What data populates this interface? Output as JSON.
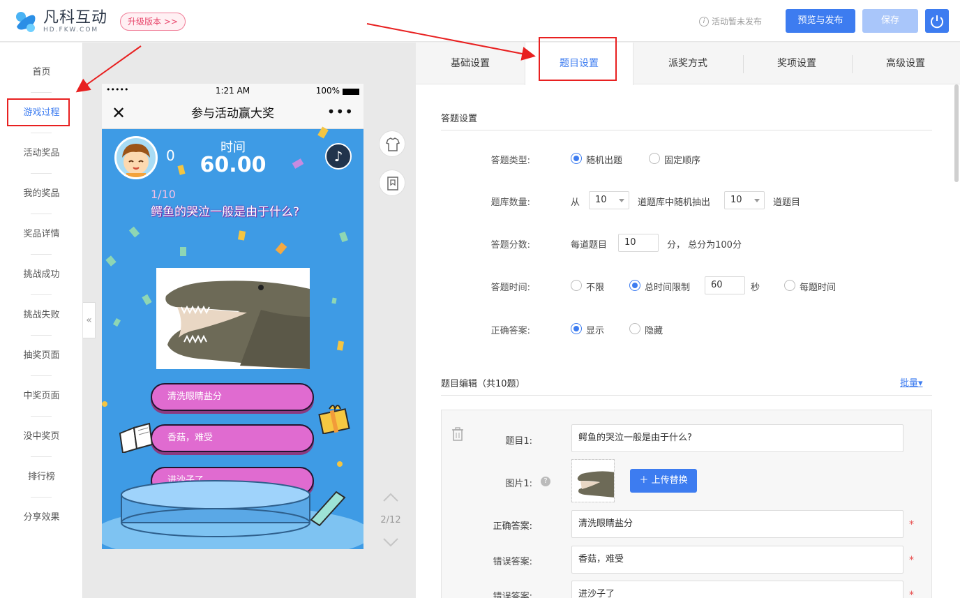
{
  "header": {
    "logo_cn": "凡科互动",
    "logo_en": "HD.FKW.COM",
    "upgrade_label": "升级版本 >>",
    "status_text": "活动暂未发布",
    "preview_publish_label": "预览与发布",
    "save_label": "保存"
  },
  "sidebar": {
    "items": [
      {
        "label": "首页"
      },
      {
        "label": "游戏过程"
      },
      {
        "label": "活动奖品"
      },
      {
        "label": "我的奖品"
      },
      {
        "label": "奖品详情"
      },
      {
        "label": "挑战成功"
      },
      {
        "label": "挑战失败"
      },
      {
        "label": "抽奖页面"
      },
      {
        "label": "中奖页面"
      },
      {
        "label": "没中奖页"
      },
      {
        "label": "排行榜"
      },
      {
        "label": "分享效果"
      }
    ],
    "collapse_label": "«"
  },
  "phone": {
    "signal": "•••••",
    "time": "1:21 AM",
    "battery": "100%",
    "title": "参与活动赢大奖",
    "close": "✕",
    "more": "•••",
    "score": "0",
    "time_label": "时间",
    "time_value": "60.00",
    "question_number": "1/10",
    "question_text": "鳄鱼的哭泣一般是由于什么?",
    "answers": [
      "清洗眼睛盐分",
      "香菇，难受",
      "进沙子了"
    ]
  },
  "page_nav": {
    "indicator": "2/12"
  },
  "tabs": [
    {
      "label": "基础设置"
    },
    {
      "label": "题目设置"
    },
    {
      "label": "派奖方式"
    },
    {
      "label": "奖项设置"
    },
    {
      "label": "高级设置"
    }
  ],
  "answer_settings": {
    "section_title": "答题设置",
    "type": {
      "label": "答题类型:",
      "options": [
        "随机出题",
        "固定顺序"
      ],
      "selected": "随机出题"
    },
    "bank": {
      "label": "题库数量:",
      "from": "从",
      "bank_value": "10",
      "middle": "道题库中随机抽出",
      "draw_value": "10",
      "end": "道题目"
    },
    "score": {
      "label": "答题分数:",
      "prefix": "每道题目",
      "value": "10",
      "suffix": "分， 总分为100分"
    },
    "time": {
      "label": "答题时间:",
      "options": [
        "不限",
        "总时间限制",
        "每题时间"
      ],
      "selected": "总时间限制",
      "value": "60",
      "unit": "秒"
    },
    "correct": {
      "label": "正确答案:",
      "options": [
        "显示",
        "隐藏"
      ],
      "selected": "显示"
    }
  },
  "question_edit": {
    "section_title": "题目编辑（共10题）",
    "batch_label": "批量▾",
    "question_label": "题目1:",
    "question_value": "鳄鱼的哭泣一般是由于什么?",
    "image_label": "图片1:",
    "help": "?",
    "upload_label": "上传替换",
    "correct_label": "正确答案:",
    "correct_value": "清洗眼睛盐分",
    "wrong_label_1": "错误答案:",
    "wrong_value_1": "香菇，难受",
    "wrong_label_2": "错误答案:",
    "wrong_value_2": "进沙子了",
    "required_mark": "*"
  },
  "colors": {
    "accent": "#3d7cf0",
    "annotation_red": "#e82020",
    "phone_bg": "#3e9be5",
    "answer_pink": "#e06bd0"
  }
}
